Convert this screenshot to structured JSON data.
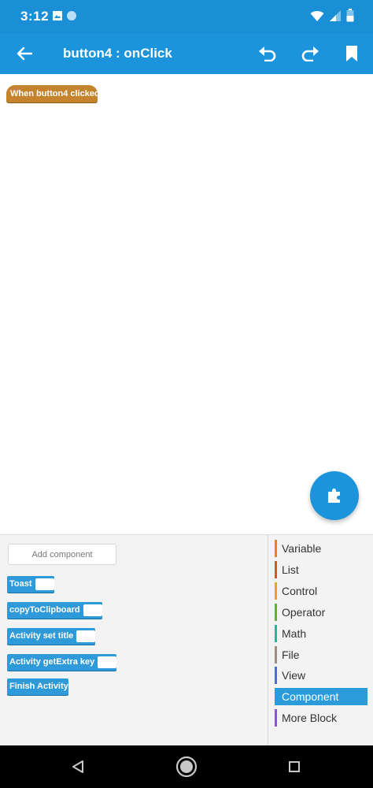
{
  "status_bar": {
    "time": "3:12"
  },
  "app_bar": {
    "title": "button4 : onClick"
  },
  "canvas": {
    "event_block_label": "When button4 clicked"
  },
  "palette": {
    "add_component_label": "Add component",
    "blocks": [
      {
        "label": "Toast"
      },
      {
        "label": "copyToClipboard"
      },
      {
        "label": "Activity set title"
      },
      {
        "label": "Activity getExtra key"
      },
      {
        "label": "Finish Activity"
      }
    ]
  },
  "categories": [
    {
      "label": "Variable",
      "color": "#e8821e"
    },
    {
      "label": "List",
      "color": "#cc5a2a"
    },
    {
      "label": "Control",
      "color": "#e2a42b"
    },
    {
      "label": "Operator",
      "color": "#5fb03a"
    },
    {
      "label": "Math",
      "color": "#2bb39b"
    },
    {
      "label": "File",
      "color": "#a08c84"
    },
    {
      "label": "View",
      "color": "#4a6fd1"
    },
    {
      "label": "Component",
      "color": "#2b9bda"
    },
    {
      "label": "More Block",
      "color": "#8a55d4"
    }
  ],
  "colors": {
    "primary": "#1c94dc",
    "status_bar": "#1a8fd6",
    "event_block": "#c6832e",
    "component_block": "#2f9ad9"
  }
}
